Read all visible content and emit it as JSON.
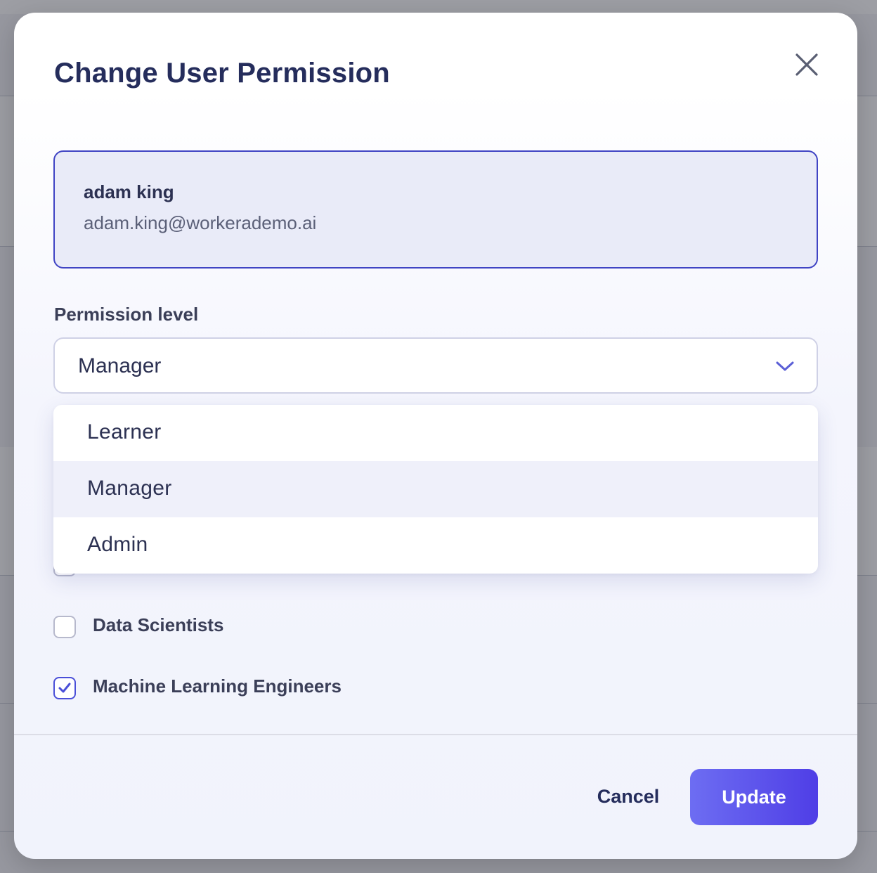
{
  "modal": {
    "title": "Change User Permission",
    "close_icon": "close-icon"
  },
  "user": {
    "name": "adam king",
    "email": "adam.king@workerademo.ai"
  },
  "permission": {
    "label": "Permission level",
    "selected": "Manager",
    "options": [
      {
        "label": "Learner",
        "highlighted": false
      },
      {
        "label": "Manager",
        "highlighted": true
      },
      {
        "label": "Admin",
        "highlighted": false
      }
    ]
  },
  "teams": [
    {
      "label": "Data Scientists",
      "checked": false
    },
    {
      "label": "Machine Learning Engineers",
      "checked": true
    }
  ],
  "footer": {
    "cancel_label": "Cancel",
    "update_label": "Update"
  },
  "colors": {
    "accent": "#4f3ee6",
    "accent_light": "#6d6df2",
    "title_text": "#252d5c",
    "card_border": "#4044c4",
    "card_bg": "#e9ebf8"
  }
}
